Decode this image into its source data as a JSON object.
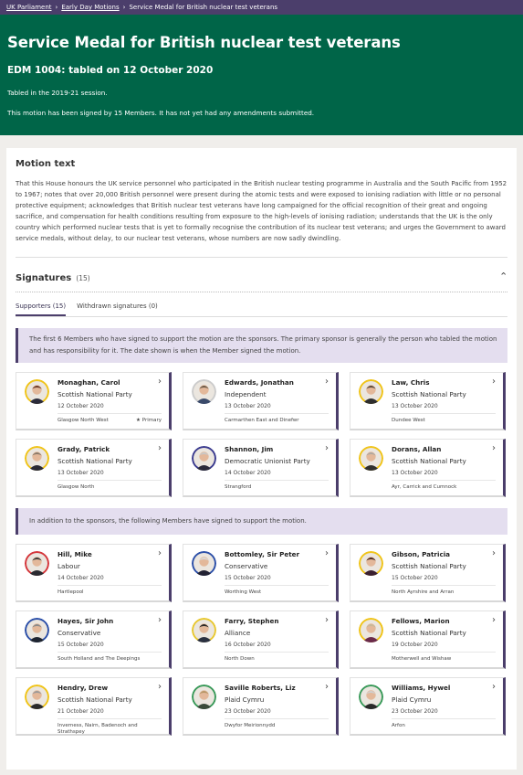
{
  "breadcrumbs": [
    "UK Parliament",
    "Early Day Motions",
    "Service Medal for British nuclear test veterans"
  ],
  "title": "Service Medal for British nuclear test veterans",
  "subtitle": "EDM 1004: tabled on 12 October 2020",
  "session_text": "Tabled in the 2019-21 session.",
  "signed_text": "This motion has been signed by 15 Members. It has not yet had any amendments submitted.",
  "motion": {
    "heading": "Motion text",
    "body": "That this House honours the UK service personnel who participated in the British nuclear testing programme in Australia and the South Pacific from 1952 to 1967; notes that over 20,000 British personnel were present during the atomic tests and were exposed to ionising radiation with little or no personal protective equipment; acknowledges that British nuclear test veterans have long campaigned for the official recognition of their great and ongoing sacrifice, and compensation for health conditions resulting from exposure to the high-levels of ionising radiation; understands that the UK is the only country which performed nuclear tests that is yet to formally recognise the contribution of its nuclear test veterans; and urges the Government to award service medals, without delay, to our nuclear test veterans, whose numbers are now sadly dwindling."
  },
  "signatures": {
    "heading": "Signatures",
    "count": "(15)",
    "tabs": [
      "Supporters (15)",
      "Withdrawn signatures (0)"
    ],
    "sponsor_notice": "The first 6 Members who have signed to support the motion are the sponsors. The primary sponsor is generally the person who tabled the motion and has responsibility for it. The date shown is when the Member signed the motion.",
    "supporter_notice": "In addition to the sponsors, the following Members have signed to support the motion.",
    "primary_label": "Primary",
    "sponsors": [
      {
        "name": "Monaghan, Carol",
        "party": "Scottish National Party",
        "date": "12 October 2020",
        "constituency": "Glasgow North West",
        "primary": true,
        "ring": "#f0c419",
        "hair": "#6b3b2a",
        "suit": "#2b2b3a"
      },
      {
        "name": "Edwards, Jonathan",
        "party": "Independent",
        "date": "13 October 2020",
        "constituency": "Carmarthen East and Dinefwr",
        "primary": false,
        "ring": "#cccccc",
        "hair": "#6a5a48",
        "suit": "#3a4a6a"
      },
      {
        "name": "Law, Chris",
        "party": "Scottish National Party",
        "date": "13 October 2020",
        "constituency": "Dundee West",
        "primary": false,
        "ring": "#f0c419",
        "hair": "#5a4a3a",
        "suit": "#2e2e2e"
      },
      {
        "name": "Grady, Patrick",
        "party": "Scottish National Party",
        "date": "13 October 2020",
        "constituency": "Glasgow North",
        "primary": false,
        "ring": "#f0c419",
        "hair": "#8a7a6a",
        "suit": "#2a2a35"
      },
      {
        "name": "Shannon, Jim",
        "party": "Democratic Unionist Party",
        "date": "14 October 2020",
        "constituency": "Strangford",
        "primary": false,
        "ring": "#3b3b8f",
        "hair": "#c8c8c8",
        "suit": "#2a2a3a"
      },
      {
        "name": "Dorans, Allan",
        "party": "Scottish National Party",
        "date": "13 October 2020",
        "constituency": "Ayr, Carrick and Cumnock",
        "primary": false,
        "ring": "#f0c419",
        "hair": "#b0a8a0",
        "suit": "#30302e"
      }
    ],
    "supporters": [
      {
        "name": "Hill, Mike",
        "party": "Labour",
        "date": "14 October 2020",
        "constituency": "Hartlepool",
        "ring": "#d4353a",
        "hair": "#3a3a3a",
        "suit": "#2a2a30"
      },
      {
        "name": "Bottomley, Sir Peter",
        "party": "Conservative",
        "date": "15 October 2020",
        "constituency": "Worthing West",
        "ring": "#2b4fa8",
        "hair": "#d8d8d8",
        "suit": "#222233"
      },
      {
        "name": "Gibson, Patricia",
        "party": "Scottish National Party",
        "date": "15 October 2020",
        "constituency": "North Ayrshire and Arran",
        "ring": "#f0c419",
        "hair": "#4a2a24",
        "suit": "#3a2030"
      },
      {
        "name": "Hayes, Sir John",
        "party": "Conservative",
        "date": "15 October 2020",
        "constituency": "South Holland and The Deepings",
        "ring": "#2b4fa8",
        "hair": "#8a8a8a",
        "suit": "#1f2530"
      },
      {
        "name": "Farry, Stephen",
        "party": "Alliance",
        "date": "16 October 2020",
        "constituency": "North Down",
        "ring": "#e8c830",
        "hair": "#2a2a2a",
        "suit": "#2a3040"
      },
      {
        "name": "Fellows, Marion",
        "party": "Scottish National Party",
        "date": "19 October 2020",
        "constituency": "Motherwell and Wishaw",
        "ring": "#f0c419",
        "hair": "#c8b898",
        "suit": "#6a2a4a"
      },
      {
        "name": "Hendry, Drew",
        "party": "Scottish National Party",
        "date": "21 October 2020",
        "constituency": "Inverness, Nairn, Badenoch and Strathspey",
        "ring": "#f0c419",
        "hair": "#9a9a9a",
        "suit": "#2a2a2a"
      },
      {
        "name": "Saville Roberts, Liz",
        "party": "Plaid Cymru",
        "date": "23 October 2020",
        "constituency": "Dwyfor Meirionnydd",
        "ring": "#3a9a5a",
        "hair": "#b89868",
        "suit": "#3a4a3a"
      },
      {
        "name": "Williams, Hywel",
        "party": "Plaid Cymru",
        "date": "23 October 2020",
        "constituency": "Arfon",
        "ring": "#3a9a5a",
        "hair": "#d0d0d0",
        "suit": "#2a2a2a"
      }
    ]
  }
}
